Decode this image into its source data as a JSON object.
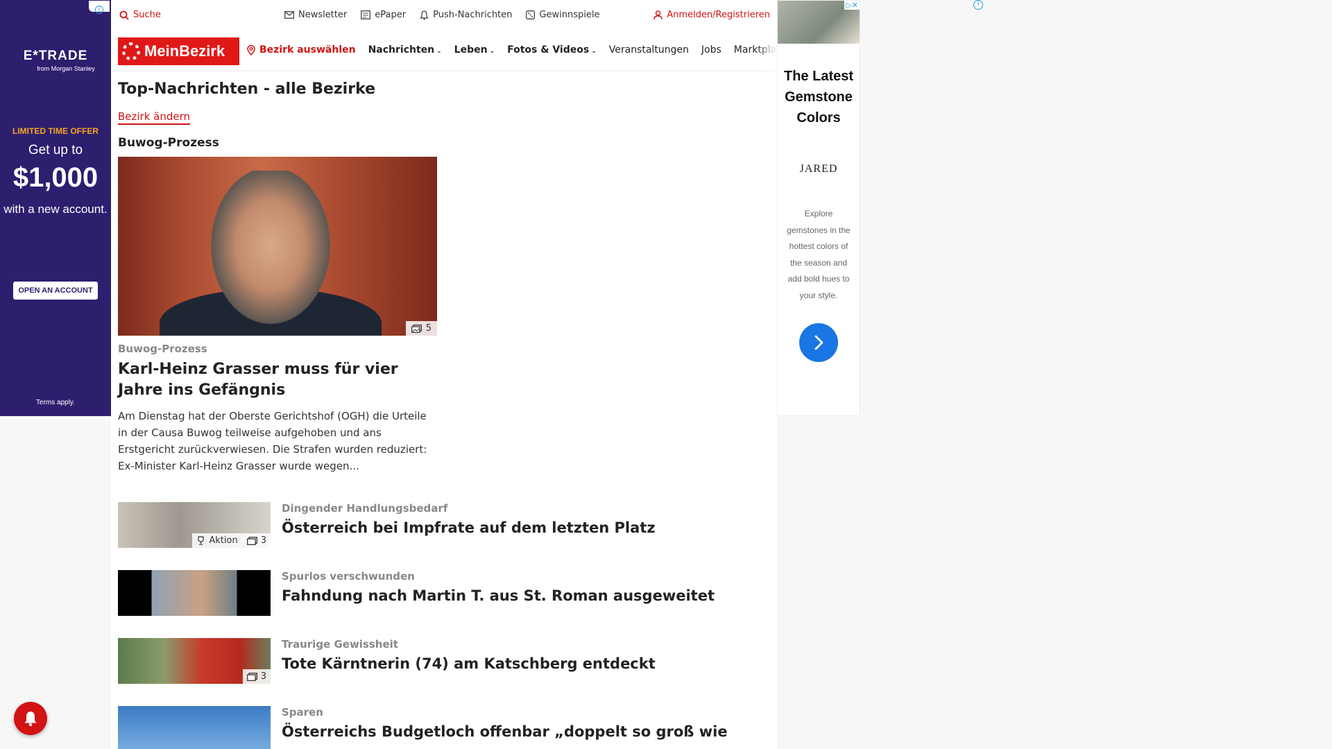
{
  "ad_left": {
    "brand": "E*TRADE",
    "brand_sub": "from Morgan Stanley",
    "offer": "LIMITED TIME OFFER",
    "get": "Get up to",
    "amount": "$1,000",
    "with": "with a new account.",
    "cta": "OPEN AN ACCOUNT",
    "terms": "Terms apply."
  },
  "ad_right": {
    "headline": "The Latest Gemstone Colors",
    "logo": "JARED",
    "desc": "Explore gemstones in the hottest colors of the season and add bold hues to your style."
  },
  "topbar": {
    "search": "Suche",
    "newsletter": "Newsletter",
    "epaper": "ePaper",
    "push": "Push-Nachrichten",
    "gewinnspiele": "Gewinnspiele",
    "login": "Anmelden/Registrieren"
  },
  "nav": {
    "logo": "MeinBezirk",
    "district": "Bezirk auswählen",
    "nachrichten": "Nachrichten",
    "leben": "Leben",
    "fotos": "Fotos & Videos",
    "veranstaltungen": "Veranstaltungen",
    "jobs": "Jobs",
    "marktplatz": "Marktplatz"
  },
  "main": {
    "title": "Top-Nachrichten - alle Bezirke",
    "change_district": "Bezirk ändern",
    "section": "Buwog-Prozess",
    "hero": {
      "photo_count": "5",
      "kicker": "Buwog-Prozess",
      "title": "Karl-Heinz Grasser muss für vier Jahre ins Gefängnis",
      "text": "Am Dienstag hat der Oberste Gerichtshof (OGH) die Urteile in der Causa Buwog teilweise aufgehoben und ans Erstgericht zurückverwiesen. Die Strafen wurden reduziert: Ex-Minister Karl-Heinz Grasser wurde wegen..."
    },
    "articles": [
      {
        "kicker": "Dingender Handlungsbedarf",
        "title": "Österreich bei Impfrate auf dem letzten Platz",
        "action": "Aktion",
        "count": "3"
      },
      {
        "kicker": "Spurlos verschwunden",
        "title": "Fahndung nach Martin T. aus St. Roman ausgeweitet"
      },
      {
        "kicker": "Traurige Gewissheit",
        "title": "Tote Kärntnerin (74) am Katschberg entdeckt",
        "count": "3"
      },
      {
        "kicker": "Sparen",
        "title": "Österreichs Budgetloch offenbar „doppelt so groß wie"
      }
    ]
  }
}
